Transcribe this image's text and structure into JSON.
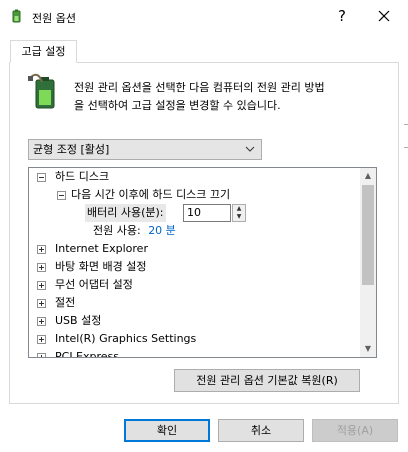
{
  "window": {
    "title": "전원 옵션",
    "help_label": "?",
    "close_icon": "close-icon"
  },
  "tabs": [
    {
      "label": "고급 설정",
      "active": true
    }
  ],
  "description": {
    "line1": "전원 관리 옵션을 선택한 다음 컴퓨터의 전원 관리 방법",
    "line2": "을 선택하여 고급 설정을 변경할 수 있습니다."
  },
  "plan_select": {
    "value": "균형 조정 [활성]"
  },
  "tree": {
    "items": [
      {
        "label": "하드 디스크",
        "expanded": true
      },
      {
        "label": "다음 시간 이후에 하드 디스크 끄기",
        "expanded": true
      },
      {
        "battery_label": "배터리 사용(분):",
        "battery_value": "10"
      },
      {
        "plugged_label": "전원 사용:",
        "plugged_value": "20 분"
      },
      {
        "label": "Internet Explorer"
      },
      {
        "label": "바탕 화면 배경 설정"
      },
      {
        "label": "무선 어댑터 설정"
      },
      {
        "label": "절전"
      },
      {
        "label": "USB 설정"
      },
      {
        "label": "Intel(R) Graphics Settings"
      },
      {
        "label": "PCI Express"
      }
    ]
  },
  "buttons": {
    "restore": "전원 관리 옵션 기본값 복원(R)",
    "ok": "확인",
    "cancel": "취소",
    "apply": "적용(A)"
  },
  "colors": {
    "accent": "#0078d7",
    "link": "#0066cc"
  }
}
